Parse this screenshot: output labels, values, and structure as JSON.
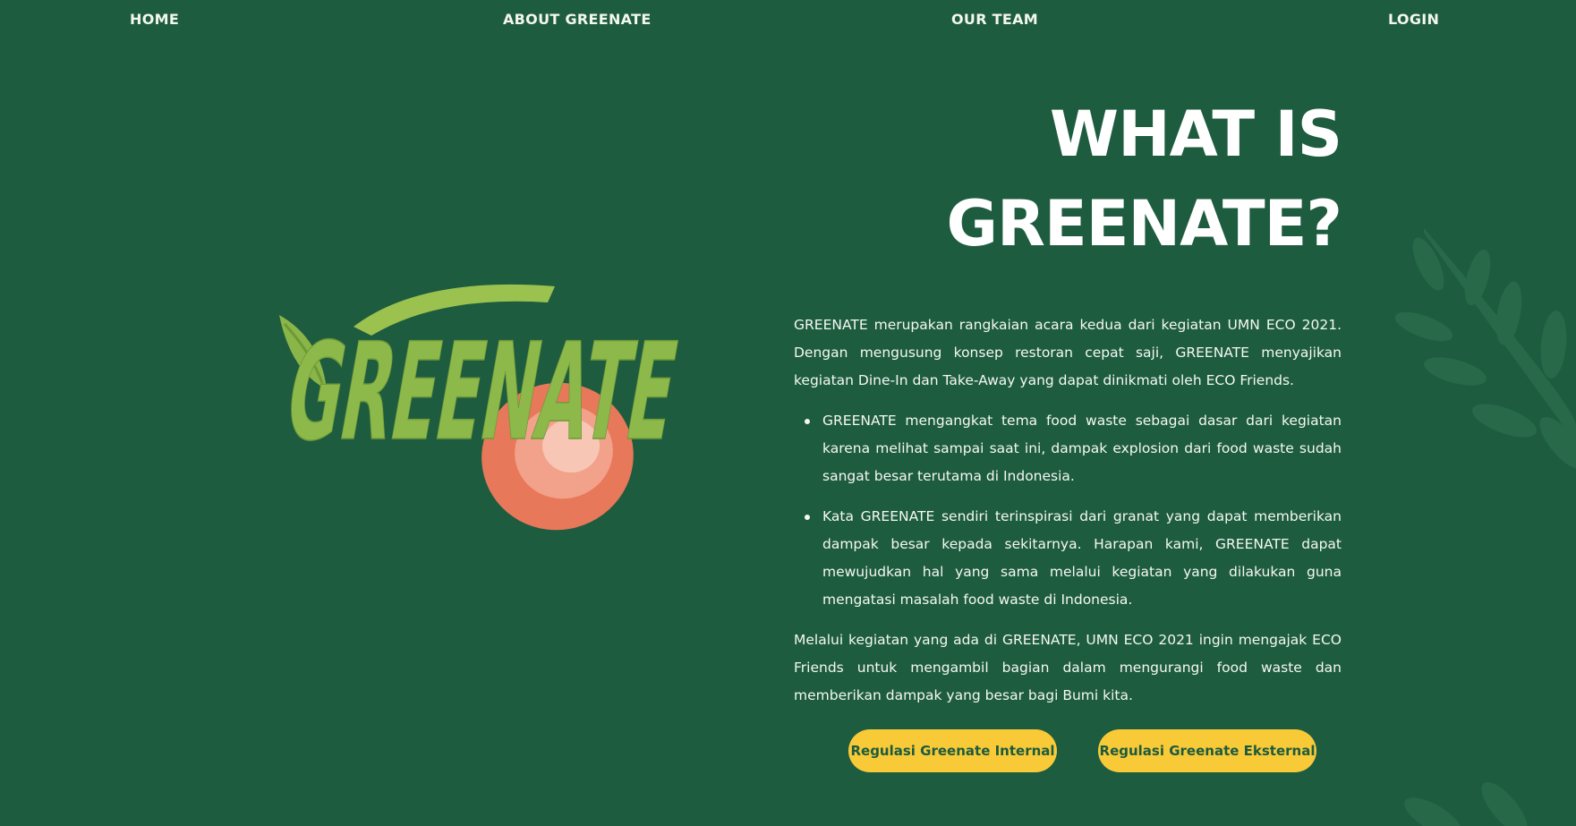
{
  "nav": {
    "home": "HOME",
    "about": "ABOUT GREENATE",
    "team": "OUR TEAM",
    "login": "LOGIN"
  },
  "logo": {
    "text": "GREENATE",
    "icon": "greenate-logo"
  },
  "heading": {
    "line1": "WHAT IS",
    "line2": "GREENATE?"
  },
  "content": {
    "intro": "GREENATE merupakan rangkaian acara kedua dari kegiatan UMN ECO 2021. Dengan mengusung konsep restoran cepat saji, GREENATE menyajikan kegiatan Dine-In dan Take-Away yang dapat dinikmati oleh ECO Friends.",
    "bullets": [
      "GREENATE mengangkat tema food waste sebagai dasar dari kegiatan karena melihat sampai saat ini, dampak explosion dari food waste sudah sangat besar terutama di Indonesia.",
      "Kata GREENATE sendiri terinspirasi dari granat yang dapat memberikan dampak besar kepada sekitarnya. Harapan kami, GREENATE dapat mewujudkan hal yang sama melalui kegiatan yang dilakukan guna mengatasi masalah food waste di Indonesia."
    ],
    "closing": "Melalui kegiatan yang ada di GREENATE, UMN ECO 2021 ingin mengajak ECO Friends untuk mengambil bagian dalam mengurangi food waste dan memberikan dampak yang besar bagi Bumi kita."
  },
  "buttons": {
    "internal": "Regulasi Greenate Internal",
    "external": "Regulasi Greenate Eksternal"
  },
  "colors": {
    "background": "#1e5c40",
    "button": "#f9ca38",
    "button_text": "#1d5b3e",
    "logo_green": "#8db84a",
    "logo_orange": "#e8785a"
  }
}
